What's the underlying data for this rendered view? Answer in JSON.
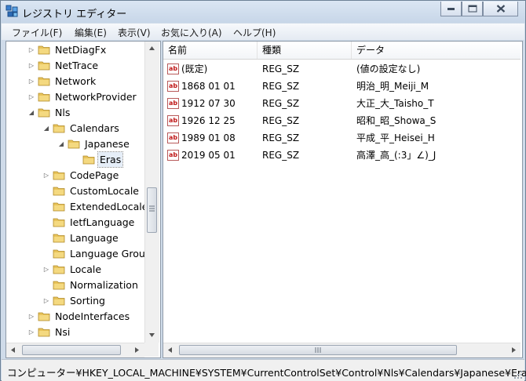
{
  "window": {
    "title": "レジストリ エディター"
  },
  "menu": [
    "ファイル(F)",
    "編集(E)",
    "表示(V)",
    "お気に入り(A)",
    "ヘルプ(H)"
  ],
  "tree": [
    {
      "label": "NetDiagFx",
      "icon": "folder-icon"
    },
    {
      "label": "NetTrace",
      "icon": "folder-icon"
    },
    {
      "label": "Network",
      "icon": "folder-icon"
    },
    {
      "label": "NetworkProvider",
      "icon": "folder-icon"
    },
    {
      "label": "Nls",
      "icon": "folder-open-icon"
    },
    {
      "label": "Calendars",
      "icon": "folder-open-icon"
    },
    {
      "label": "Japanese",
      "icon": "folder-open-icon"
    },
    {
      "label": "Eras",
      "icon": "folder-icon",
      "selected": true
    },
    {
      "label": "CodePage",
      "icon": "folder-icon"
    },
    {
      "label": "CustomLocale",
      "icon": "folder-icon"
    },
    {
      "label": "ExtendedLocale",
      "icon": "folder-icon"
    },
    {
      "label": "IetfLanguage",
      "icon": "folder-icon"
    },
    {
      "label": "Language",
      "icon": "folder-icon"
    },
    {
      "label": "Language Group",
      "icon": "folder-icon"
    },
    {
      "label": "Locale",
      "icon": "folder-icon"
    },
    {
      "label": "Normalization",
      "icon": "folder-icon"
    },
    {
      "label": "Sorting",
      "icon": "folder-icon"
    },
    {
      "label": "NodeInterfaces",
      "icon": "folder-icon"
    },
    {
      "label": "Nsi",
      "icon": "folder-icon"
    }
  ],
  "list": {
    "columns": [
      "名前",
      "種類",
      "データ"
    ],
    "icon_text": "ab",
    "rows": [
      {
        "name": "(既定)",
        "type": "REG_SZ",
        "data": "(値の設定なし)"
      },
      {
        "name": "1868 01 01",
        "type": "REG_SZ",
        "data": "明治_明_Meiji_M"
      },
      {
        "name": "1912 07 30",
        "type": "REG_SZ",
        "data": "大正_大_Taisho_T"
      },
      {
        "name": "1926 12 25",
        "type": "REG_SZ",
        "data": "昭和_昭_Showa_S"
      },
      {
        "name": "1989 01 08",
        "type": "REG_SZ",
        "data": "平成_平_Heisei_H"
      },
      {
        "name": "2019 05 01",
        "type": "REG_SZ",
        "data": "高澤_高_(:3」∠)_J"
      }
    ]
  },
  "status": {
    "path": "コンピューター¥HKEY_LOCAL_MACHINE¥SYSTEM¥CurrentControlSet¥Control¥Nls¥Calendars¥Japanese¥Eras"
  },
  "colors": {
    "title_bg": "#cfdbe9",
    "folder": "#e8c35a",
    "reg_icon": "#c01818"
  }
}
